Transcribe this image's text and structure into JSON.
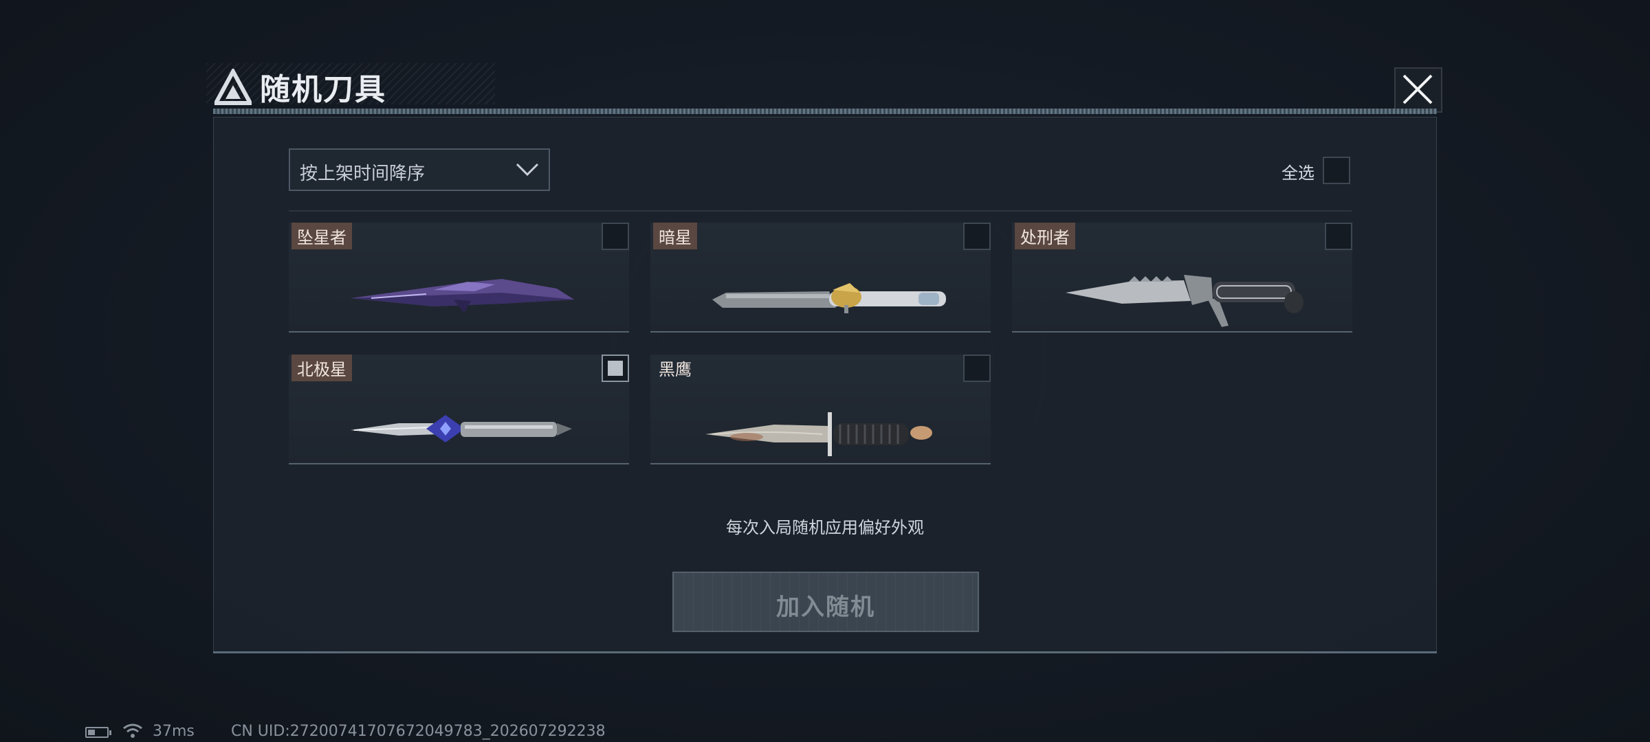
{
  "header": {
    "title": "随机刀具"
  },
  "toolbar": {
    "sort_value": "按上架时间降序",
    "select_all_label": "全选"
  },
  "knives": [
    {
      "name": "坠星者",
      "checked": false
    },
    {
      "name": "暗星",
      "checked": false
    },
    {
      "name": "处刑者",
      "checked": false
    },
    {
      "name": "北极星",
      "checked": true
    },
    {
      "name": "黑鹰",
      "checked": false
    }
  ],
  "hint": "每次入局随机应用偏好外观",
  "join_button": "加入随机",
  "status": {
    "ping": "37ms",
    "uid": "CN UID:27200741707672049783_202607292238"
  },
  "colors": {
    "accent_tag": "#6e5246",
    "panel": "#1c232d",
    "background": "#141a23"
  },
  "icons": [
    "logo-icon",
    "close-icon",
    "chevron-down-icon",
    "battery-icon",
    "wifi-icon"
  ]
}
